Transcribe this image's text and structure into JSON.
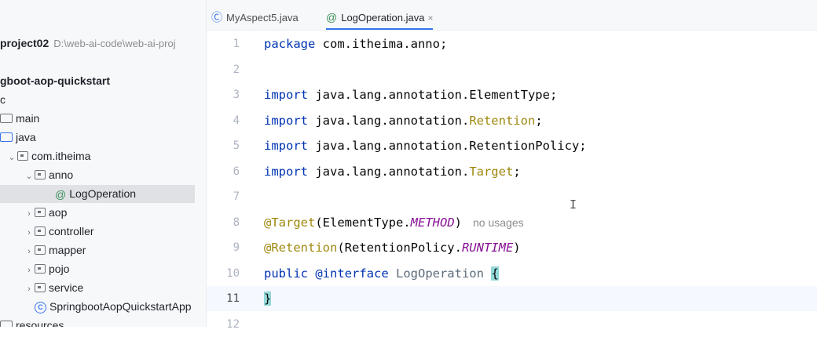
{
  "project": {
    "name": "project02",
    "path": "D:\\web-ai-code\\web-ai-proj",
    "tree": [
      {
        "label": "gboot-aop-quickstart",
        "bold": true,
        "indent": 0,
        "kind": "module"
      },
      {
        "label": "c",
        "indent": 0,
        "kind": "text"
      },
      {
        "label": "main",
        "indent": 0,
        "kind": "folder-plain"
      },
      {
        "label": "java",
        "indent": 0,
        "kind": "folder"
      },
      {
        "label": "com.itheima",
        "indent": 1,
        "kind": "package",
        "chevron": "⌄"
      },
      {
        "label": "anno",
        "indent": 2,
        "kind": "package",
        "chevron": "⌄"
      },
      {
        "label": "LogOperation",
        "indent": 4,
        "kind": "annotation",
        "selected": true
      },
      {
        "label": "aop",
        "indent": 2,
        "kind": "package",
        "chevron": "›"
      },
      {
        "label": "controller",
        "indent": 2,
        "kind": "package",
        "chevron": "›"
      },
      {
        "label": "mapper",
        "indent": 2,
        "kind": "package",
        "chevron": "›"
      },
      {
        "label": "pojo",
        "indent": 2,
        "kind": "package",
        "chevron": "›"
      },
      {
        "label": "service",
        "indent": 2,
        "kind": "package",
        "chevron": "›"
      },
      {
        "label": "SpringbootAopQuickstartApp",
        "indent": 3,
        "kind": "class"
      },
      {
        "label": "resources",
        "indent": 0,
        "kind": "folder-plain"
      }
    ]
  },
  "tabs": [
    {
      "label": "MyAspect5.java",
      "icon": "class-icon",
      "active": false
    },
    {
      "label": "LogOperation.java",
      "icon": "annotation-icon",
      "active": true,
      "close": "×"
    }
  ],
  "editor": {
    "line_numbers": [
      "1",
      "2",
      "3",
      "4",
      "5",
      "6",
      "7",
      "8",
      "9",
      "10",
      "11",
      "12"
    ],
    "current_line": 11,
    "lines": {
      "l1_kw": "package",
      "l1_rest": " com.itheima.anno;",
      "l3_kw": "import",
      "l3_rest": " java.lang.annotation.ElementType;",
      "l4_kw": "import",
      "l4_pre": " java.lang.annotation.",
      "l4_ann": "Retention",
      "l4_end": ";",
      "l5_kw": "import",
      "l5_rest": " java.lang.annotation.RetentionPolicy;",
      "l6_kw": "import",
      "l6_pre": " java.lang.annotation.",
      "l6_ann": "Target",
      "l6_end": ";",
      "l8_ann": "@Target",
      "l8_open": "(ElementType.",
      "l8_const": "METHOD",
      "l8_close": ")",
      "l8_hint": "no usages",
      "l9_ann": "@Retention",
      "l9_open": "(RetentionPolicy.",
      "l9_const": "RUNTIME",
      "l9_close": ")",
      "l10_kw": "public",
      "l10_kw2": " @interface",
      "l10_name": " LogOperation ",
      "l10_brace": "{",
      "l11_brace": "}"
    },
    "text_cursor": "I"
  }
}
